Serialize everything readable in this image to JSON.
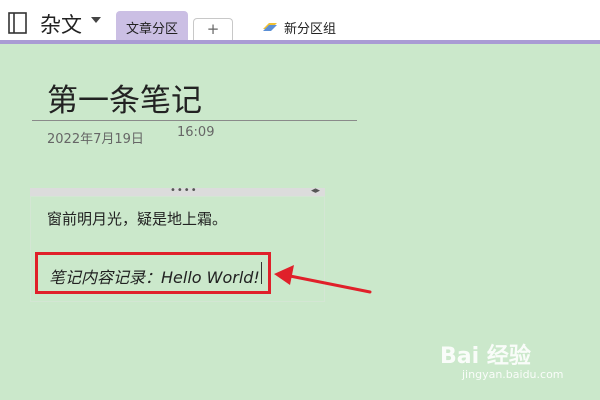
{
  "toolbar": {
    "notebook_title": "杂文",
    "notebook_icon": "notebook-icon",
    "active_tab": "文章分区",
    "add_tab": "+",
    "section_group": "新分区组",
    "section_group_icon": "section-group-icon",
    "accent_color": "#a99bd4"
  },
  "page": {
    "title": "第一条笔记",
    "date": "2022年7月19日",
    "time": "16:09",
    "background_color": "#cbe8cb"
  },
  "note": {
    "line1": "窗前明月光，疑是地上霜。",
    "line2": "笔记内容记录：Hello World!",
    "highlight_color": "#e0202a"
  },
  "watermark": {
    "brand": "Bai 经验",
    "url": "jingyan.baidu.com"
  }
}
